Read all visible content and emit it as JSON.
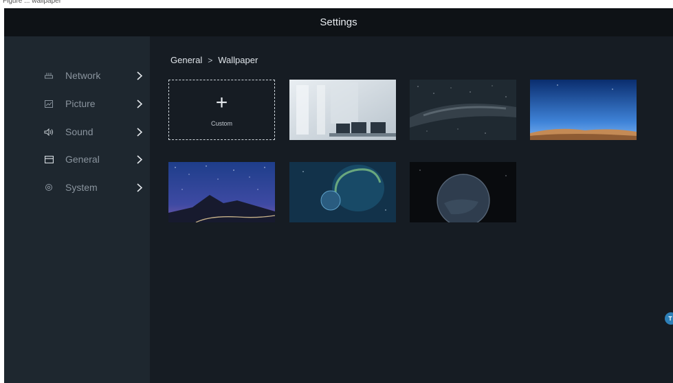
{
  "doc_caption": "Figure ... wallpaper",
  "titlebar": {
    "title": "Settings"
  },
  "sidebar": {
    "items": [
      {
        "label": "Network",
        "icon": "network-icon"
      },
      {
        "label": "Picture",
        "icon": "picture-icon"
      },
      {
        "label": "Sound",
        "icon": "sound-icon"
      },
      {
        "label": "General",
        "icon": "general-icon"
      },
      {
        "label": "System",
        "icon": "system-icon"
      }
    ]
  },
  "breadcrumb": {
    "parent": "General",
    "separator": ">",
    "current": "Wallpaper"
  },
  "wallpapers": {
    "custom_label": "Custom",
    "custom_icon": "plus-icon",
    "items": [
      {
        "name": "meeting-room"
      },
      {
        "name": "milky-way"
      },
      {
        "name": "desert-sky"
      },
      {
        "name": "mountain-road-night"
      },
      {
        "name": "planet-rings"
      },
      {
        "name": "dark-planet"
      }
    ]
  },
  "colors": {
    "background": "#161c23",
    "titlebar": "#0e1216",
    "sidebar": "#1e272f",
    "accent": "#2d7fb7"
  }
}
